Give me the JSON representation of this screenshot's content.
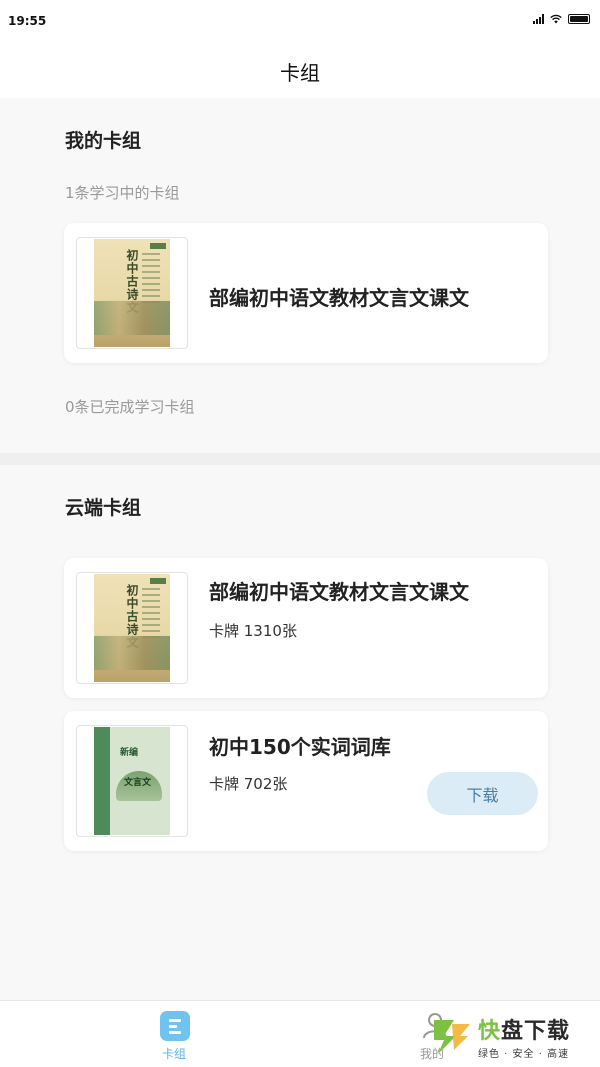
{
  "status": {
    "time": "19:55"
  },
  "header": {
    "title": "卡组"
  },
  "my_decks": {
    "heading": "我的卡组",
    "in_progress_label": "1条学习中的卡组",
    "items": [
      {
        "title": "部编初中语文教材文言文课文",
        "cover": "gushiwen-cover"
      }
    ],
    "completed_label": "0条已完成学习卡组"
  },
  "cloud_decks": {
    "heading": "云端卡组",
    "items": [
      {
        "title": "部编初中语文教材文言文课文",
        "meta": "卡牌  1310张",
        "cover": "gushiwen-cover"
      },
      {
        "title": "初中150个实词词库",
        "meta": "卡牌  702张",
        "cover": "ciku-cover",
        "download_label": "下载"
      }
    ]
  },
  "tabbar": {
    "tabs": [
      {
        "label": "卡组",
        "icon": "deck-icon",
        "active": true
      },
      {
        "label": "我的",
        "icon": "profile-icon",
        "active": false
      }
    ]
  },
  "watermark": {
    "brand_fast": "快",
    "brand_rest": "盘下载",
    "tagline": "绿色 · 安全 · 高速"
  },
  "colors": {
    "accent": "#5ab3e6",
    "download_bg": "#dcecf6",
    "download_text": "#4a7ea6",
    "watermark_green": "#7cc142"
  }
}
